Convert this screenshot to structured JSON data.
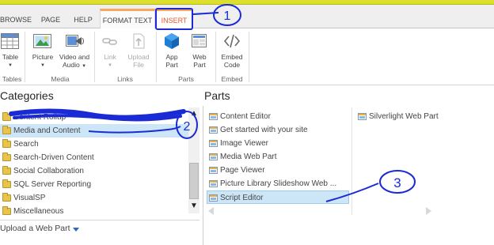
{
  "tabs": [
    "BROWSE",
    "PAGE",
    "HELP",
    "FORMAT TEXT",
    "INSERT"
  ],
  "ribbon": {
    "buttons": [
      {
        "label1": "Table",
        "label2": "",
        "icon": "table-icon"
      },
      {
        "label1": "Picture",
        "label2": "",
        "icon": "picture-icon"
      },
      {
        "label1": "Video and",
        "label2": "Audio",
        "icon": "video-audio-icon"
      },
      {
        "label1": "Link",
        "label2": "",
        "icon": "link-icon"
      },
      {
        "label1": "Upload",
        "label2": "File",
        "icon": "upload-file-icon"
      },
      {
        "label1": "App",
        "label2": "Part",
        "icon": "app-part-icon"
      },
      {
        "label1": "Web",
        "label2": "Part",
        "icon": "web-part-icon"
      },
      {
        "label1": "Embed",
        "label2": "Code",
        "icon": "embed-code-icon"
      }
    ],
    "groups": [
      "Tables",
      "Media",
      "Links",
      "Parts",
      "Embed"
    ]
  },
  "categories": {
    "heading": "Categories",
    "items": [
      "Content Rollup",
      "Media and Content",
      "Search",
      "Search-Driven Content",
      "Social Collaboration",
      "SQL Server Reporting",
      "VisualSP",
      "Miscellaneous"
    ],
    "selected": "Media and Content",
    "upload_label": "Upload a Web Part"
  },
  "parts": {
    "heading": "Parts",
    "column1": [
      "Content Editor",
      "Get started with your site",
      "Image Viewer",
      "Media Web Part",
      "Page Viewer",
      "Picture Library Slideshow Web ...",
      "Script Editor"
    ],
    "column2": [
      "Silverlight Web Part"
    ],
    "selected": "Script Editor"
  },
  "annotations": {
    "step1": "1",
    "step2": "2",
    "step3": "3",
    "ink_color": "#1a2bd6"
  },
  "colors": {
    "context_tab_accent": "#f7a85a",
    "active_tab_text": "#e8582a",
    "selection": "#cde6f7"
  }
}
